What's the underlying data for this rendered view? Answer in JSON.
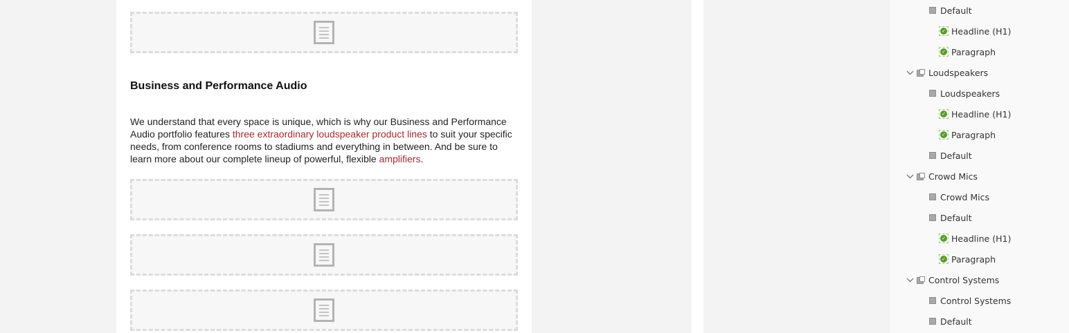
{
  "article": {
    "heading": "Business and Performance Audio",
    "paragraph": {
      "t1": "We understand that every space is unique, which is why our Business and Performance Audio portfolio features ",
      "link1": "three extraordinary loudspeaker product lines",
      "t2": " to suit your specific needs, from conference rooms to stadiums and everything in between. And be sure to learn more about our complete lineup of powerful, flexible ",
      "link2": "amplifiers",
      "t3": "."
    }
  },
  "tree": {
    "items": [
      {
        "label": "Default",
        "type": "square"
      },
      {
        "label": "Headline (H1)",
        "type": "check"
      },
      {
        "label": "Paragraph",
        "type": "check"
      },
      {
        "label": "Loudspeakers",
        "type": "folder",
        "expanded": true
      },
      {
        "label": "Loudspeakers",
        "type": "square"
      },
      {
        "label": "Headline (H1)",
        "type": "check"
      },
      {
        "label": "Paragraph",
        "type": "check"
      },
      {
        "label": "Default",
        "type": "square"
      },
      {
        "label": "Crowd Mics",
        "type": "folder",
        "expanded": true
      },
      {
        "label": "Crowd Mics",
        "type": "square"
      },
      {
        "label": "Default",
        "type": "square"
      },
      {
        "label": "Headline (H1)",
        "type": "check"
      },
      {
        "label": "Paragraph",
        "type": "check"
      },
      {
        "label": "Control Systems",
        "type": "folder",
        "expanded": true
      },
      {
        "label": "Control Systems",
        "type": "square"
      },
      {
        "label": "Default",
        "type": "square"
      }
    ]
  },
  "icons": {
    "placeholder": "document-placeholder-icon",
    "check": "check-circle-icon",
    "chevron": "chevron-down-icon",
    "node": "square-node-icon",
    "folder": "folder-node-icon"
  },
  "colors": {
    "link": "#a42b2f",
    "check": "#5a9c2a",
    "canvas_bg": "#ffffff",
    "workspace_bg": "#f3f3f3"
  }
}
